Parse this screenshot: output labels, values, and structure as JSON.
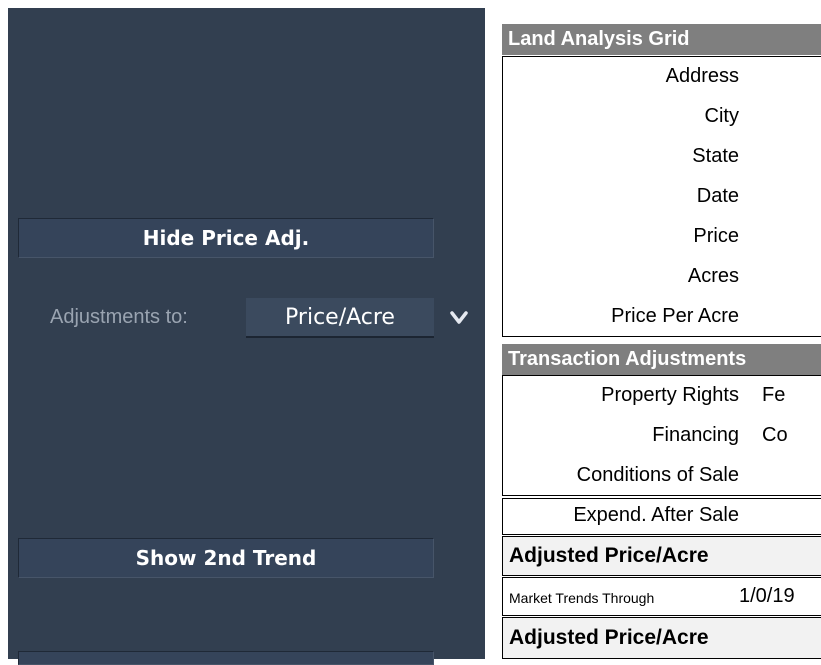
{
  "left_panel": {
    "hide_button_label": "Hide Price Adj.",
    "show_button_label": "Show 2nd Trend",
    "adjustments_label": "Adjustments to:",
    "adjustments_value": "Price/Acre"
  },
  "grid": {
    "title": "Land Analysis Grid",
    "property_rows": [
      {
        "label": "Address",
        "value": ""
      },
      {
        "label": "City",
        "value": ""
      },
      {
        "label": "State",
        "value": ""
      },
      {
        "label": "Date",
        "value": ""
      },
      {
        "label": "Price",
        "value": ""
      },
      {
        "label": "Acres",
        "value": ""
      },
      {
        "label": "Price Per Acre",
        "value": ""
      }
    ],
    "transaction_header": "Transaction Adjustments",
    "transaction_rows": [
      {
        "label": "Property Rights",
        "value": "Fe"
      },
      {
        "label": "Financing",
        "value": "Co"
      },
      {
        "label": "Conditions of Sale",
        "value": ""
      }
    ],
    "expend_row": {
      "label": "Expend. After Sale",
      "value": ""
    },
    "adjusted_label_1": "Adjusted Price/Acre",
    "market_trends_label": "Market Trends Through",
    "market_trends_value": "1/0/19",
    "adjusted_label_2": "Adjusted Price/Acre"
  },
  "colors": {
    "panel_bg": "#323f50",
    "button_bg": "#35445a",
    "header_bg": "#7f7f7f"
  }
}
